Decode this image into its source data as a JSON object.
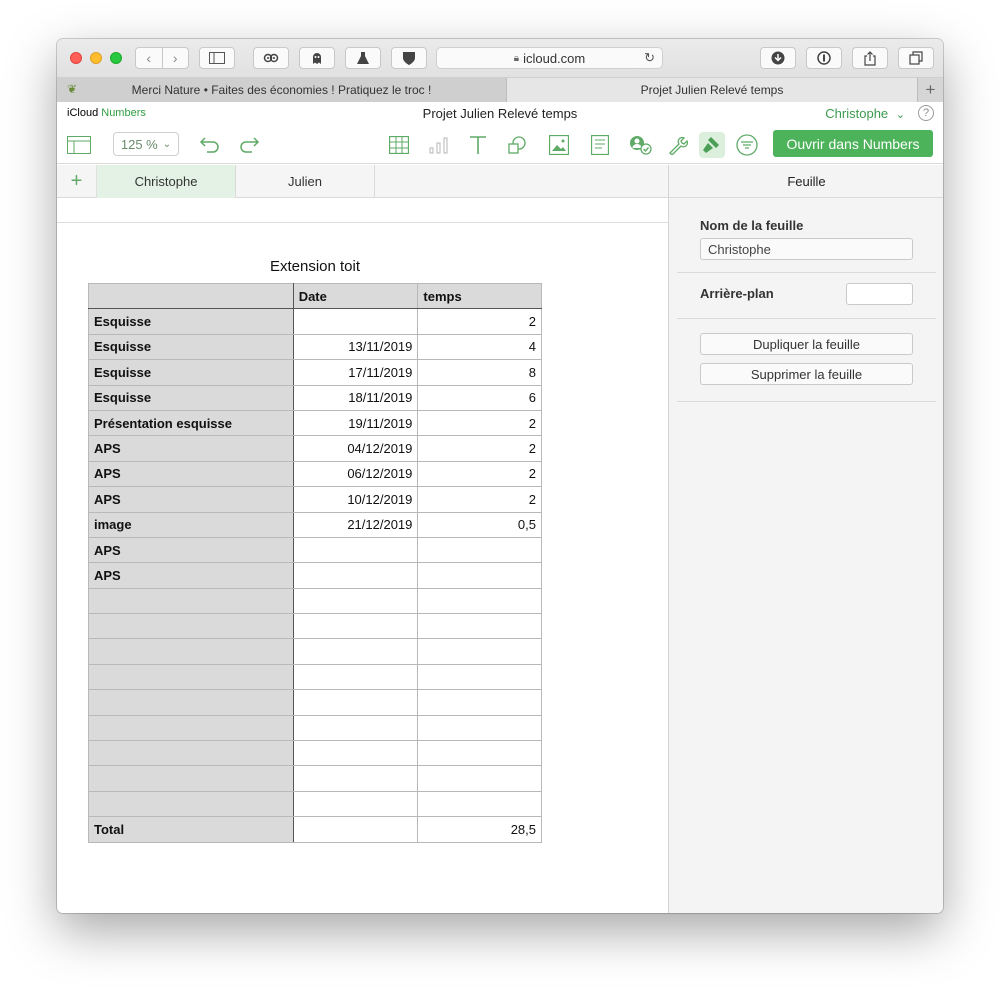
{
  "browser": {
    "url": "icloud.com",
    "tabs": [
      {
        "label": "Merci Nature • Faites des économies ! Pratiquez le troc !"
      },
      {
        "label": "Projet Julien Relevé temps"
      }
    ]
  },
  "app": {
    "brand_icloud": "iCloud",
    "brand_numbers": "Numbers",
    "title": "Projet Julien Relevé temps",
    "user": "Christophe",
    "help": "?"
  },
  "toolbar": {
    "zoom": "125 %",
    "open_label": "Ouvrir dans Numbers",
    "accent": "#4db35a"
  },
  "sheets": {
    "add": "+",
    "tabs": [
      "Christophe",
      "Julien"
    ],
    "active": 0
  },
  "table": {
    "title": "Extension toit",
    "headers": [
      "",
      "Date",
      "temps"
    ],
    "rows": [
      [
        "Esquisse",
        "",
        "2"
      ],
      [
        "Esquisse",
        "13/11/2019",
        "4"
      ],
      [
        "Esquisse",
        "17/11/2019",
        "8"
      ],
      [
        "Esquisse",
        "18/11/2019",
        "6"
      ],
      [
        "Présentation esquisse",
        "19/11/2019",
        "2"
      ],
      [
        "APS",
        "04/12/2019",
        "2"
      ],
      [
        "APS",
        "06/12/2019",
        "2"
      ],
      [
        "APS",
        "10/12/2019",
        "2"
      ],
      [
        "image",
        "21/12/2019",
        "0,5"
      ],
      [
        "APS",
        "",
        ""
      ],
      [
        "APS",
        "",
        ""
      ],
      [
        "",
        "",
        ""
      ],
      [
        "",
        "",
        ""
      ],
      [
        "",
        "",
        ""
      ],
      [
        "",
        "",
        ""
      ],
      [
        "",
        "",
        ""
      ],
      [
        "",
        "",
        ""
      ],
      [
        "",
        "",
        ""
      ],
      [
        "",
        "",
        ""
      ],
      [
        "",
        "",
        ""
      ]
    ],
    "footer": [
      "Total",
      "",
      "28,5"
    ]
  },
  "inspector": {
    "header": "Feuille",
    "sheet_name_label": "Nom de la feuille",
    "sheet_name_value": "Christophe",
    "background_label": "Arrière-plan",
    "duplicate_label": "Dupliquer la feuille",
    "delete_label": "Supprimer la feuille"
  }
}
